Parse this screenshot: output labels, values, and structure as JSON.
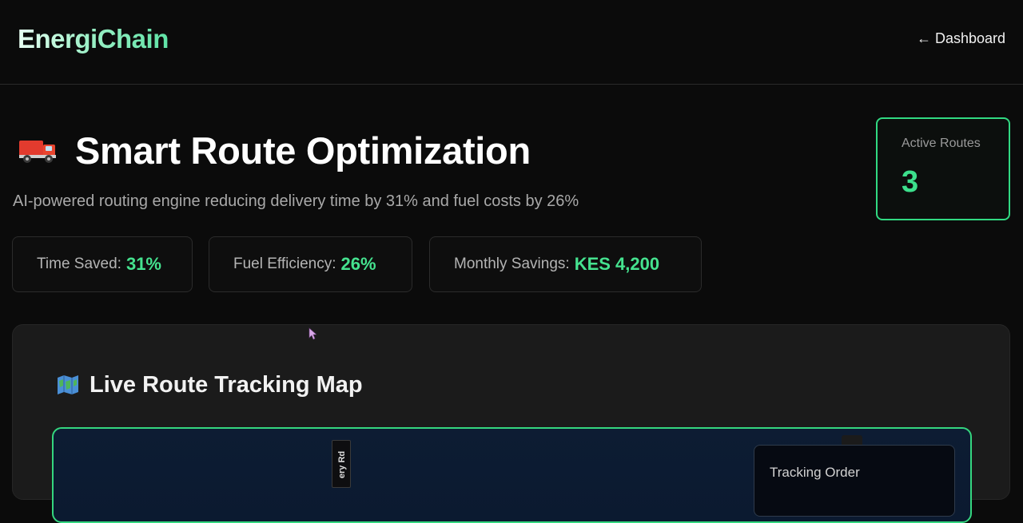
{
  "header": {
    "brand": "EnergiChain",
    "back_link": "← Dashboard"
  },
  "hero": {
    "icon": "delivery-truck-icon",
    "title": "Smart Route Optimization",
    "subtitle": "AI-powered routing engine reducing delivery time by 31% and fuel costs by 26%"
  },
  "active_routes": {
    "label": "Active Routes",
    "value": "3"
  },
  "stats": [
    {
      "label": "Time Saved:",
      "value": "31%"
    },
    {
      "label": "Fuel Efficiency:",
      "value": "26%"
    },
    {
      "label": "Monthly Savings:",
      "value": "KES 4,200"
    }
  ],
  "map_panel": {
    "icon": "world-map-icon",
    "title": "Live Route Tracking Map",
    "road_label": "ery Rd",
    "tracking_popup_title": "Tracking Order"
  },
  "colors": {
    "accent_green": "#3ce08c",
    "background": "#0b0b0b",
    "panel": "#1b1b1b",
    "map_water": "#0d1c33"
  }
}
